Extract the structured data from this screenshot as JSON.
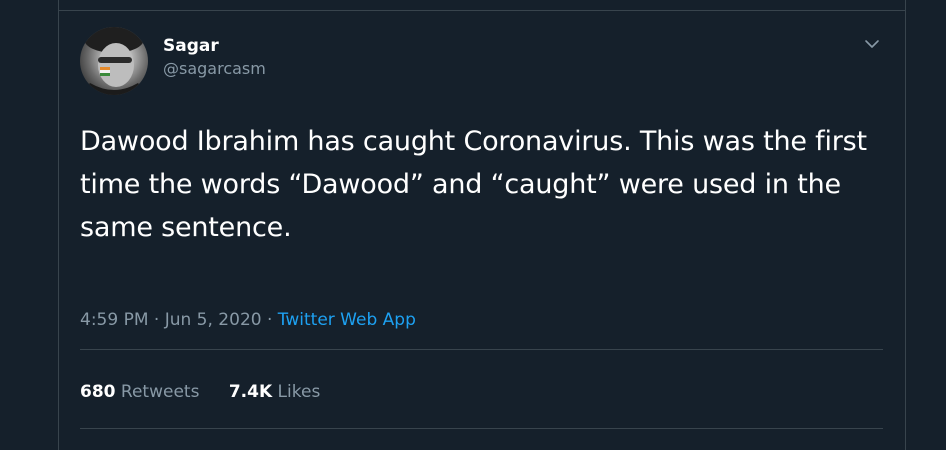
{
  "tweet": {
    "author": {
      "name": "Sagar",
      "handle": "@sagarcasm",
      "avatar_icon": "profile-photo"
    },
    "text": "Dawood Ibrahim has caught Coronavirus. This was the first\ntime the words “Dawood” and “caught” were used in the same sentence.",
    "time": "4:59 PM",
    "separator": "·",
    "date": "Jun 5, 2020",
    "source": "Twitter Web App",
    "stats": {
      "retweets_count": "680",
      "retweets_label": "Retweets",
      "likes_count": "7.4K",
      "likes_label": "Likes"
    }
  },
  "colors": {
    "background": "#15202b",
    "border": "#38444d",
    "primary_text": "#ffffff",
    "secondary_text": "#8899a6",
    "link": "#1da1f2"
  }
}
